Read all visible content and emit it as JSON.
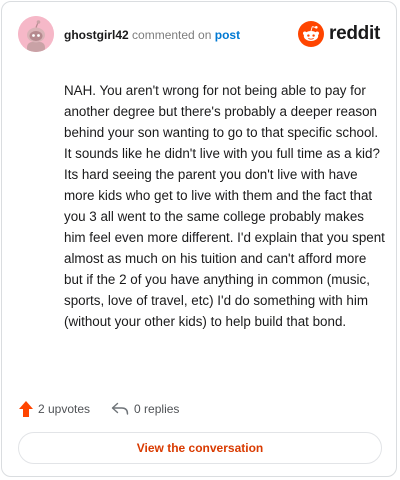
{
  "comment": {
    "author": "ghostgirl42",
    "action_text": "commented on",
    "post_link": "post",
    "body": "NAH. You aren't wrong for not being able to pay for another degree but there's probably a deeper reason behind your son wanting to go to that specific school. It sounds like he didn't live with you full time as a kid? Its hard seeing the parent you don't live with have more kids who get to live with them and the fact that you 3 all went to the same college probably makes him feel even more different. I'd explain that you spent almost as much on his tuition and can't afford more but if the 2 of you have anything in common (music, sports, love of travel, etc) I'd do something with him (without your other kids) to help build that bond."
  },
  "brand": {
    "logo_text": "reddit",
    "color": "#ff4500"
  },
  "actions": {
    "upvotes_label": "2 upvotes",
    "replies_label": "0 replies",
    "upvote_icon": "arrow-up-icon",
    "reply_icon": "reply-arrow-icon"
  },
  "footer": {
    "view_label": "View the conversation"
  }
}
